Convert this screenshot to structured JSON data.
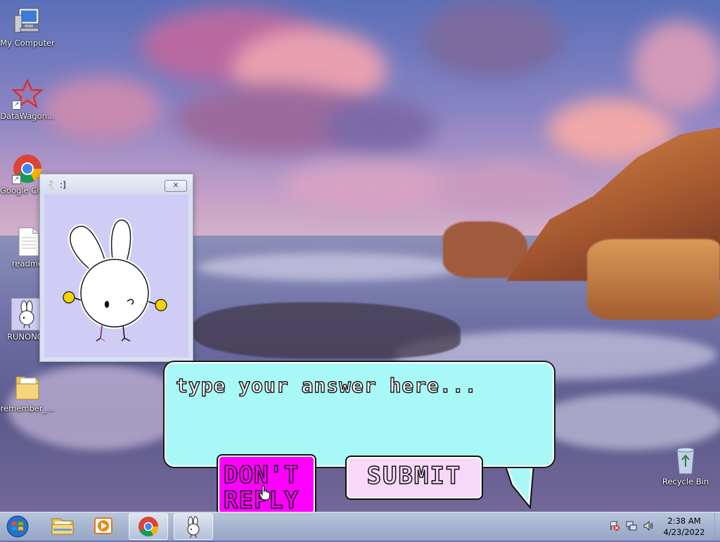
{
  "desktop": {
    "icons": [
      {
        "label": "My Computer",
        "icon": "computer-icon"
      },
      {
        "label": "DataWagon...",
        "icon": "datawagon-icon"
      },
      {
        "label": "Google Chrome",
        "icon": "chrome-icon"
      },
      {
        "label": "readme",
        "icon": "text-file-icon"
      },
      {
        "label": "RUNONCE",
        "icon": "bunny-icon"
      },
      {
        "label": "remember_...",
        "icon": "folder-icon"
      },
      {
        "label": "Recycle Bin",
        "icon": "recycle-bin-icon"
      }
    ]
  },
  "bunny_window": {
    "title": ":]",
    "close_label": "✕"
  },
  "answer_dialog": {
    "placeholder": "type your answer here...",
    "value": "",
    "dont_reply_label": "DON'T REPLY",
    "submit_label": "SUBMIT",
    "colors": {
      "bubble": "#a9f8f8",
      "dont_reply": "#ff00ff",
      "submit": "#f8d8f8"
    }
  },
  "taskbar": {
    "pinned": [
      "start-orb-icon",
      "explorer-icon",
      "media-player-icon",
      "chrome-icon",
      "bunny-app-icon"
    ],
    "tray_icons": [
      "action-center-icon",
      "network-icon",
      "volume-icon"
    ],
    "time": "2:38 AM",
    "date": "4/23/2022"
  }
}
